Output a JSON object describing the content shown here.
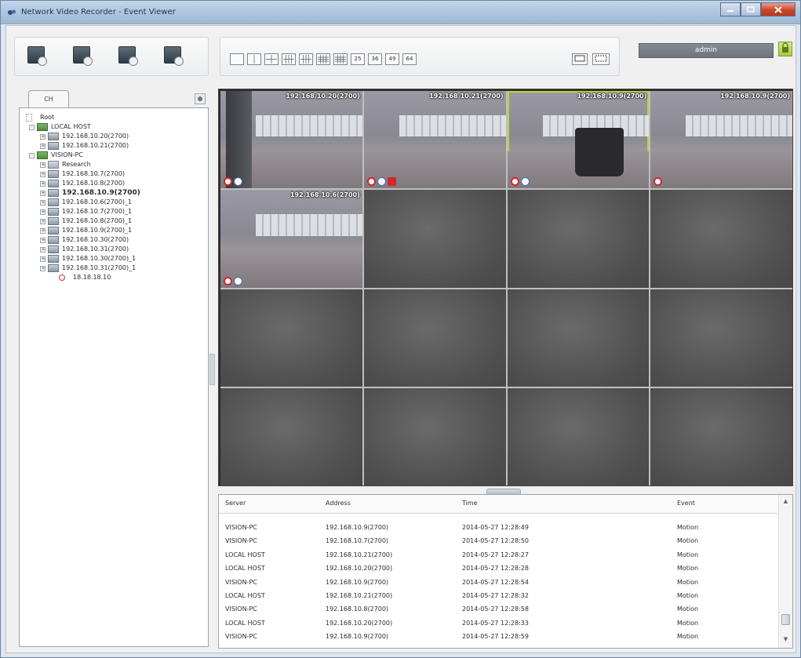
{
  "window": {
    "title": "Network Video Recorder - Event Viewer"
  },
  "toolbar": {
    "layouts": [
      "",
      "",
      "",
      "",
      "",
      "",
      "",
      "25",
      "36",
      "49",
      "64"
    ],
    "user": "admin"
  },
  "left_panel": {
    "tab_label": "CH",
    "tree": [
      {
        "label": "Root",
        "indent": 0,
        "icon": "root",
        "expander": ""
      },
      {
        "label": "LOCAL HOST",
        "indent": 1,
        "icon": "server",
        "expander": "-"
      },
      {
        "label": "192.168.10.20(2700)",
        "indent": 2,
        "icon": "cam",
        "expander": "+"
      },
      {
        "label": "192.168.10.21(2700)",
        "indent": 2,
        "icon": "cam",
        "expander": "+"
      },
      {
        "label": "VISION-PC",
        "indent": 1,
        "icon": "server",
        "expander": "-"
      },
      {
        "label": "Research",
        "indent": 2,
        "icon": "folder",
        "expander": "+"
      },
      {
        "label": "192.168.10.7(2700)",
        "indent": 2,
        "icon": "cam",
        "expander": "+"
      },
      {
        "label": "192.168.10.8(2700)",
        "indent": 2,
        "icon": "cam",
        "expander": "+"
      },
      {
        "label": "192.168.10.9(2700)",
        "indent": 2,
        "icon": "cam",
        "expander": "+",
        "bold": true
      },
      {
        "label": "192.168.10.6(2700)_1",
        "indent": 2,
        "icon": "cam",
        "expander": "+"
      },
      {
        "label": "192.168.10.7(2700)_1",
        "indent": 2,
        "icon": "cam",
        "expander": "+"
      },
      {
        "label": "192.168.10.8(2700)_1",
        "indent": 2,
        "icon": "cam",
        "expander": "+"
      },
      {
        "label": "192.168.10.9(2700)_1",
        "indent": 2,
        "icon": "cam",
        "expander": "+"
      },
      {
        "label": "192.168.10.30(2700)",
        "indent": 2,
        "icon": "cam",
        "expander": "+"
      },
      {
        "label": "192.168.10.31(2700)",
        "indent": 2,
        "icon": "cam",
        "expander": "+"
      },
      {
        "label": "192.168.10.30(2700)_1",
        "indent": 2,
        "icon": "cam",
        "expander": "+"
      },
      {
        "label": "192.168.10.31(2700)_1",
        "indent": 2,
        "icon": "cam",
        "expander": "+"
      },
      {
        "label": "18.18.18.10",
        "indent": 3,
        "icon": "alert",
        "expander": ""
      }
    ]
  },
  "video_grid": {
    "cells": [
      {
        "live": true,
        "address": "192.168.10.20(2700)",
        "badges": [
          "rec",
          "user"
        ],
        "selected": false,
        "sticker": "",
        "scene": "pillar"
      },
      {
        "live": true,
        "address": "192.168.10.21(2700)",
        "badges": [
          "rec",
          "user",
          "motion"
        ],
        "selected": false,
        "sticker": "",
        "scene": "window"
      },
      {
        "live": true,
        "address": "192.168.10.9(2700)",
        "badges": [
          "rec",
          "user"
        ],
        "selected": true,
        "sticker": "",
        "scene": "chair"
      },
      {
        "live": true,
        "address": "192.168.10.9(2700)",
        "badges": [
          "rec"
        ],
        "selected": false,
        "sticker": "",
        "scene": "window"
      },
      {
        "live": true,
        "address": "192.168.10.6(2700)",
        "badges": [
          "rec",
          "user"
        ],
        "selected": false,
        "sticker": "",
        "scene": "window"
      },
      {
        "live": false
      },
      {
        "live": false
      },
      {
        "live": false
      },
      {
        "live": false
      },
      {
        "live": false
      },
      {
        "live": false
      },
      {
        "live": false
      },
      {
        "live": false
      },
      {
        "live": false
      },
      {
        "live": false
      },
      {
        "live": false
      }
    ]
  },
  "event_log": {
    "columns": [
      "Server",
      "Address",
      "Time",
      "Event"
    ],
    "rows": [
      [
        "VISION-PC",
        "192.168.10.9(2700)",
        "2014-05-27 12:28:49",
        "Motion"
      ],
      [
        "VISION-PC",
        "192.168.10.7(2700)",
        "2014-05-27 12:28:50",
        "Motion"
      ],
      [
        "LOCAL HOST",
        "192.168.10.21(2700)",
        "2014-05-27 12:28:27",
        "Motion"
      ],
      [
        "LOCAL HOST",
        "192.168.10.20(2700)",
        "2014-05-27 12:28:28",
        "Motion"
      ],
      [
        "VISION-PC",
        "192.168.10.9(2700)",
        "2014-05-27 12:28:54",
        "Motion"
      ],
      [
        "LOCAL HOST",
        "192.168.10.21(2700)",
        "2014-05-27 12:28:32",
        "Motion"
      ],
      [
        "VISION-PC",
        "192.168.10.8(2700)",
        "2014-05-27 12:28:58",
        "Motion"
      ],
      [
        "LOCAL HOST",
        "192.168.10.20(2700)",
        "2014-05-27 12:28:33",
        "Motion"
      ],
      [
        "VISION-PC",
        "192.168.10.9(2700)",
        "2014-05-27 12:28:59",
        "Motion"
      ]
    ]
  },
  "colors": {
    "selected_cell": "#b7d63a",
    "record_badge": "#d4262c",
    "user_badge": "#3b6fb8"
  }
}
